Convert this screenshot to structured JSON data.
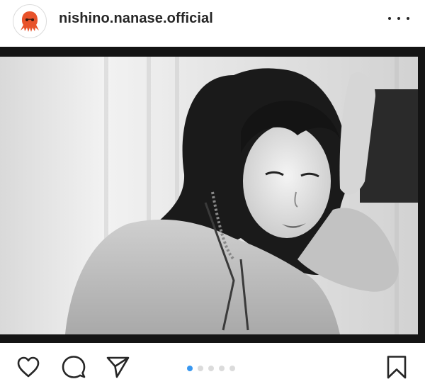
{
  "post": {
    "username": "nishino.nanase.official",
    "avatar_icon": "octopus-icon",
    "more_icon": "more-options-icon"
  },
  "carousel": {
    "total_slides": 5,
    "active_index": 0,
    "active_color": "#3897f0",
    "inactive_color": "#dbdbdb"
  },
  "actions": {
    "like_icon": "heart-icon",
    "comment_icon": "comment-icon",
    "share_icon": "send-icon",
    "save_icon": "bookmark-icon"
  },
  "colors": {
    "avatar_accent": "#e8532b",
    "text": "#262626"
  }
}
